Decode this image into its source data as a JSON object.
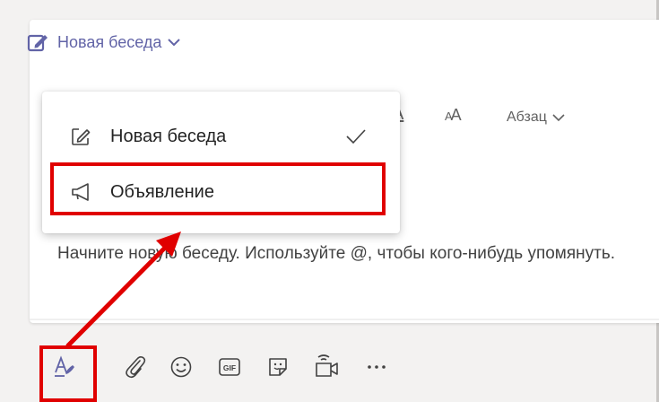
{
  "compose": {
    "mode_label": "Новая беседа",
    "placeholder": "Начните новую беседу. Используйте @, чтобы кого-нибудь упомянуть.",
    "format_toolbar": {
      "underline_glyph": "A",
      "font_size_glyph_small": "A",
      "font_size_glyph_large": "A",
      "paragraph_label": "Абзац"
    }
  },
  "menu": {
    "items": [
      {
        "label": "Новая беседа",
        "icon": "edit-icon",
        "selected": true
      },
      {
        "label": "Объявление",
        "icon": "megaphone-icon",
        "selected": false
      }
    ]
  },
  "toolbar": {
    "buttons": [
      {
        "name": "format-button",
        "icon": "format-icon"
      },
      {
        "name": "attach-button",
        "icon": "paperclip-icon"
      },
      {
        "name": "emoji-button",
        "icon": "emoji-icon"
      },
      {
        "name": "gif-button",
        "icon": "gif-icon",
        "glyph": "GIF"
      },
      {
        "name": "sticker-button",
        "icon": "sticker-icon"
      },
      {
        "name": "meet-now-button",
        "icon": "video-camera-icon"
      },
      {
        "name": "more-options-button",
        "icon": "more-icon"
      }
    ]
  },
  "colors": {
    "accent": "#6264a7",
    "annotation": "#e00000",
    "text": "#242424"
  }
}
